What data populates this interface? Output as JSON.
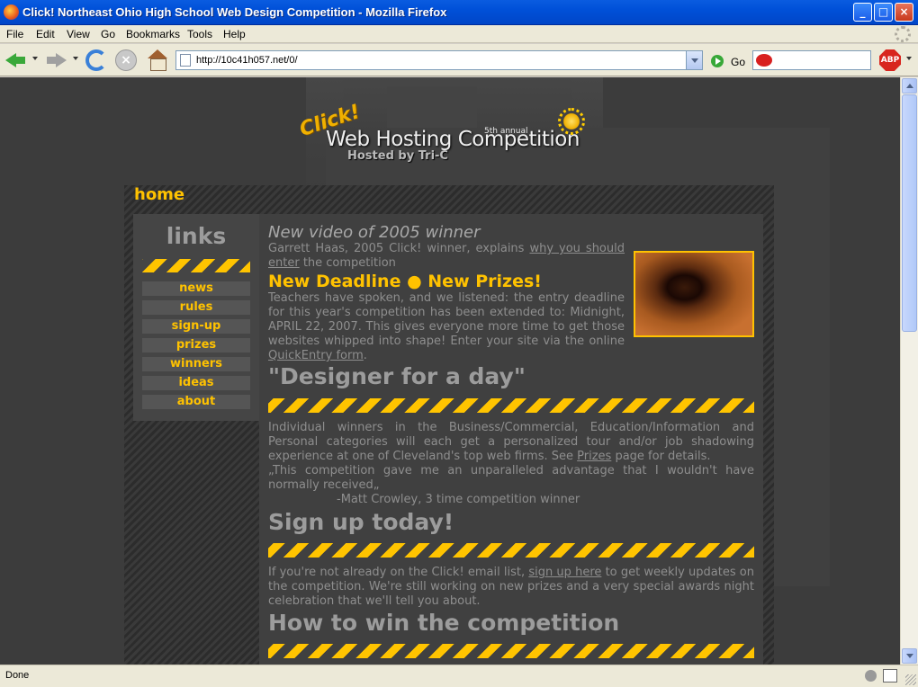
{
  "window": {
    "title": "Click! Northeast Ohio High School Web Design Competition - Mozilla Firefox",
    "buttons": {
      "minimize": "_",
      "maximize": "□",
      "close": "×"
    }
  },
  "menu": [
    "File",
    "Edit",
    "View",
    "Go",
    "Bookmarks",
    "Tools",
    "Help"
  ],
  "toolbar": {
    "url": "http://10c41h057.net/0/",
    "go_label": "Go",
    "abp_label": "ABP",
    "icons": [
      "back-icon",
      "forward-icon",
      "reload-icon",
      "stop-icon",
      "home-icon",
      "go-icon",
      "adblock-icon"
    ]
  },
  "site": {
    "logo": {
      "click": "Click!",
      "main": "Web Hosting Competition",
      "annual": "5th annual",
      "hosted": "Hosted by Tri-C"
    },
    "section_heading": "home",
    "sidebar": {
      "title": "links",
      "items": [
        "news",
        "rules",
        "sign-up",
        "prizes",
        "winners",
        "ideas",
        "about"
      ]
    },
    "video": {
      "heading": "New video of 2005 winner",
      "text_before": "Garrett Haas, 2005 Click! winner, explains ",
      "link": "why you should enter",
      "text_after": " the competition"
    },
    "deadline": {
      "heading": "New Deadline ● New Prizes!",
      "text_before": "Teachers have spoken, and we listened: the entry deadline for this year's competition has been extended to: Midnight, APRIL 22, 2007. This gives everyone more time to get those websites whipped into shape! Enter your site via the online ",
      "link": "QuickEntry form",
      "text_after": "."
    },
    "designer": {
      "heading": "\"Designer for a day\"",
      "text_before": "Individual winners in the Business/Commercial, Education/Information and Personal categories will each get a personalized tour and/or job shadowing experience at one of Cleveland's top web firms. See ",
      "link": "Prizes",
      "text_after": " page for details.",
      "quote": "„This competition gave me an unparalleled advantage that I wouldn't have normally received„",
      "quote_author": "-Matt Crowley, 3 time competition winner"
    },
    "signup": {
      "heading": "Sign up today!",
      "text_before": "If you're not already on the Click! email list, ",
      "link": "sign up here",
      "text_after": " to get weekly updates on the competition. We're still working on new prizes and a very special awards night celebration that we'll tell you about."
    },
    "howto": {
      "heading": "How to win the competition"
    }
  },
  "status": {
    "text": "Done"
  },
  "colors": {
    "accent": "#ffc200",
    "background": "#3c3c3c",
    "text": "#8e8e8e",
    "heading": "#9c9c9c"
  }
}
